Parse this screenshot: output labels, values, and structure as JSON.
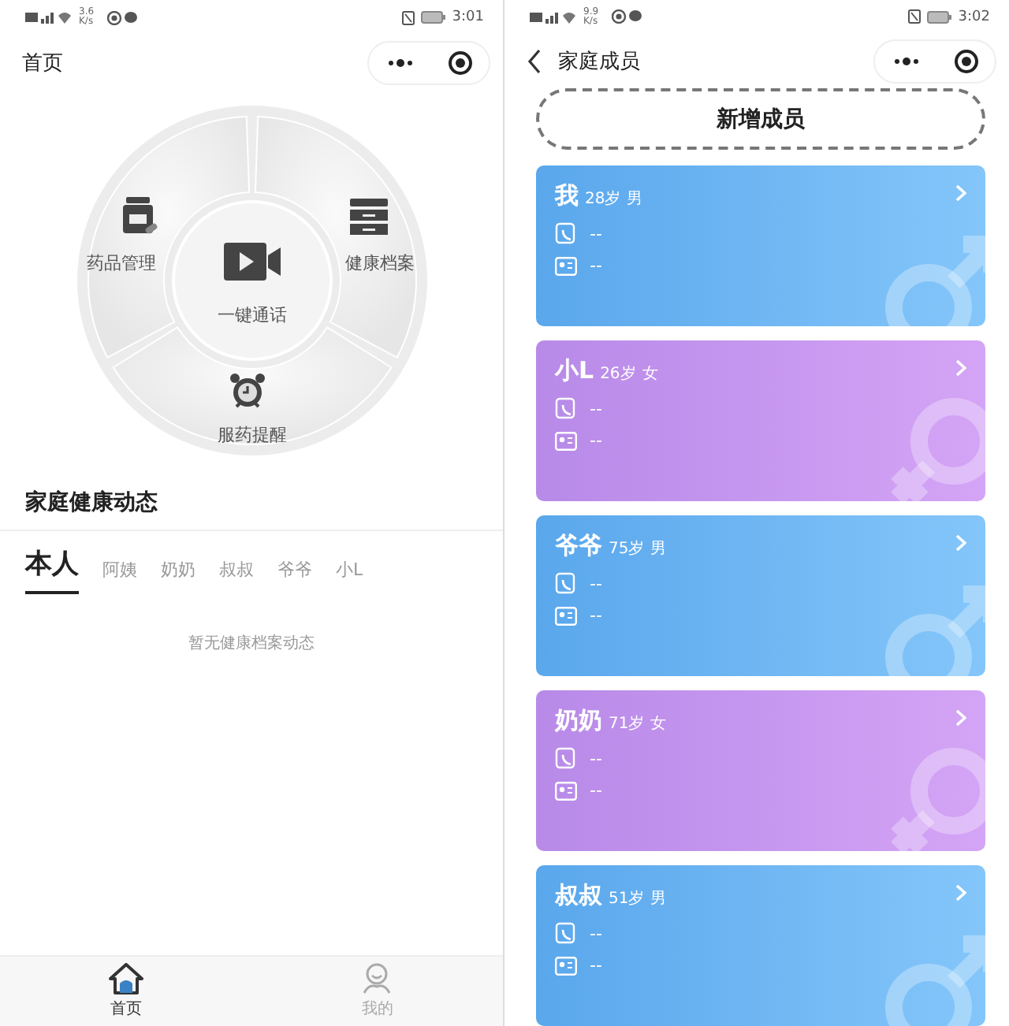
{
  "home_screen": {
    "status_bar": {
      "network_speed": "3.6 K/s",
      "time": "3:01"
    },
    "nav_title": "首页",
    "menu": [
      {
        "label": "药品管理"
      },
      {
        "label": "健康档案"
      },
      {
        "label": "一键通话"
      },
      {
        "label": "服药提醒"
      }
    ],
    "section_title": "家庭健康动态",
    "tabs": [
      {
        "label": "本人",
        "selected": true
      },
      {
        "label": "阿姨",
        "selected": false
      },
      {
        "label": "奶奶",
        "selected": false
      },
      {
        "label": "叔叔",
        "selected": false
      },
      {
        "label": "爷爷",
        "selected": false
      },
      {
        "label": "小L",
        "selected": false
      }
    ],
    "empty_text": "暂无健康档案动态",
    "bottom_nav": [
      {
        "label": "首页",
        "selected": true
      },
      {
        "label": "我的",
        "selected": false
      }
    ]
  },
  "members_screen": {
    "status_bar": {
      "network_speed": "9.9 K/s",
      "time": "3:02"
    },
    "nav_title": "家庭成员",
    "add_button": "新增成员",
    "members": [
      {
        "name": "我",
        "age": "28岁",
        "sex": "男",
        "kind": "male",
        "phone": "--",
        "id_number": "--"
      },
      {
        "name": "小L",
        "age": "26岁",
        "sex": "女",
        "kind": "female",
        "phone": "--",
        "id_number": "--"
      },
      {
        "name": "爷爷",
        "age": "75岁",
        "sex": "男",
        "kind": "male",
        "phone": "--",
        "id_number": "--"
      },
      {
        "name": "奶奶",
        "age": "71岁",
        "sex": "女",
        "kind": "female",
        "phone": "--",
        "id_number": "--"
      },
      {
        "name": "叔叔",
        "age": "51岁",
        "sex": "男",
        "kind": "male",
        "phone": "--",
        "id_number": "--"
      }
    ]
  }
}
